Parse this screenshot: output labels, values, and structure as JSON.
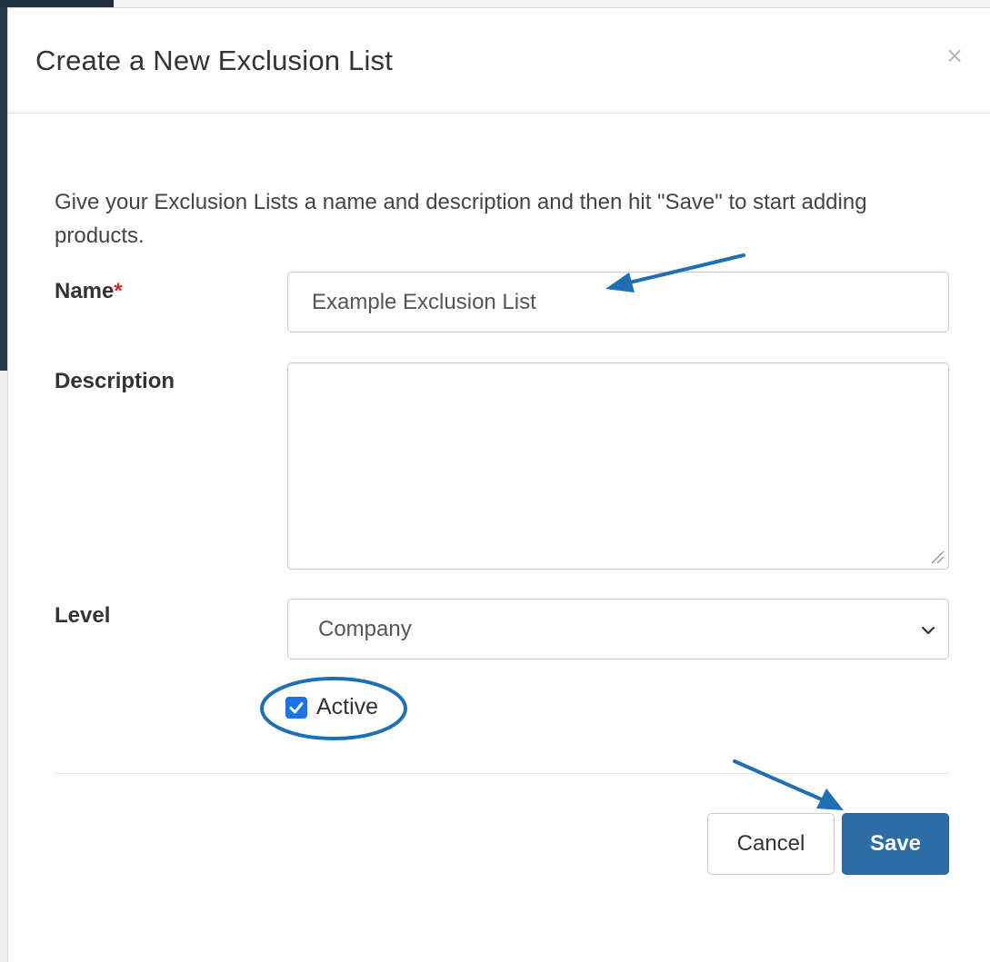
{
  "modal": {
    "title": "Create a New Exclusion List",
    "close_symbol": "×"
  },
  "form": {
    "intro": "Give your Exclusion Lists a name and description and then hit \"Save\" to start adding products.",
    "name": {
      "label": "Name",
      "required_mark": "*",
      "value": "Example Exclusion List"
    },
    "description": {
      "label": "Description",
      "value": ""
    },
    "level": {
      "label": "Level",
      "selected": "Company"
    },
    "active": {
      "label": "Active",
      "checked": true
    }
  },
  "footer": {
    "cancel_label": "Cancel",
    "save_label": "Save"
  },
  "icons": {
    "close": "close-icon",
    "chevron": "chevron-down-icon",
    "check": "checkmark-icon",
    "resize": "resize-grip-icon"
  },
  "colors": {
    "primary": "#2e6da4",
    "annotation": "#1f6fb5",
    "checkbox": "#1a73e8",
    "required": "#c9302c"
  }
}
